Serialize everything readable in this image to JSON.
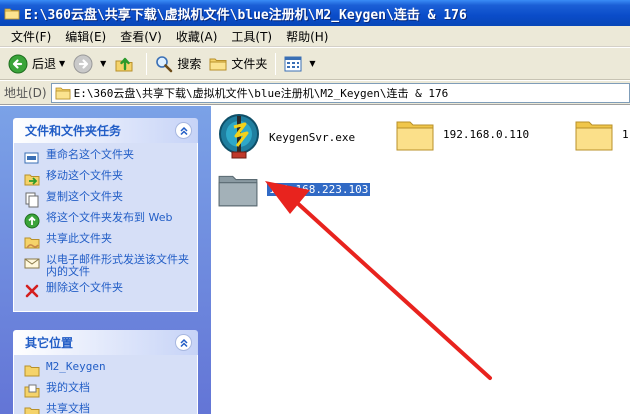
{
  "window": {
    "title": "E:\\360云盘\\共享下载\\虚拟机文件\\blue注册机\\M2_Keygen\\连击 & 176"
  },
  "menu": [
    "文件(F)",
    "编辑(E)",
    "查看(V)",
    "收藏(A)",
    "工具(T)",
    "帮助(H)"
  ],
  "toolbar": {
    "back_label": "后退",
    "search_label": "搜索",
    "folders_label": "文件夹"
  },
  "address": {
    "label": "地址(D)",
    "path": "E:\\360云盘\\共享下载\\虚拟机文件\\blue注册机\\M2_Keygen\\连击 & 176"
  },
  "tasks_panel": {
    "title": "文件和文件夹任务",
    "items": [
      {
        "label": "重命名这个文件夹",
        "icon": "rename-icon"
      },
      {
        "label": "移动这个文件夹",
        "icon": "move-icon"
      },
      {
        "label": "复制这个文件夹",
        "icon": "copy-icon"
      },
      {
        "label": "将这个文件夹发布到 Web",
        "icon": "publish-web-icon"
      },
      {
        "label": "共享此文件夹",
        "icon": "share-icon"
      },
      {
        "label": "以电子邮件形式发送该文件夹内的文件",
        "icon": "email-icon"
      },
      {
        "label": "删除这个文件夹",
        "icon": "delete-icon"
      }
    ]
  },
  "places_panel": {
    "title": "其它位置",
    "items": [
      {
        "label": "M2_Keygen",
        "icon": "folder-icon"
      },
      {
        "label": "我的文档",
        "icon": "my-documents-icon"
      },
      {
        "label": "共享文档",
        "icon": "shared-documents-icon"
      }
    ]
  },
  "files": [
    {
      "name": "KeygenSvr.exe",
      "type": "exe"
    },
    {
      "name": "192.168.0.110",
      "type": "folder"
    },
    {
      "name": "1",
      "type": "folder"
    },
    {
      "name": "192.168.223.103",
      "type": "folder",
      "selected": true
    }
  ],
  "colors": {
    "titlebar": "#0a4cc9",
    "taskpane": "#7ba2e7",
    "link": "#215dc6",
    "selection": "#316ac5",
    "annotation_arrow": "#e8231e"
  }
}
